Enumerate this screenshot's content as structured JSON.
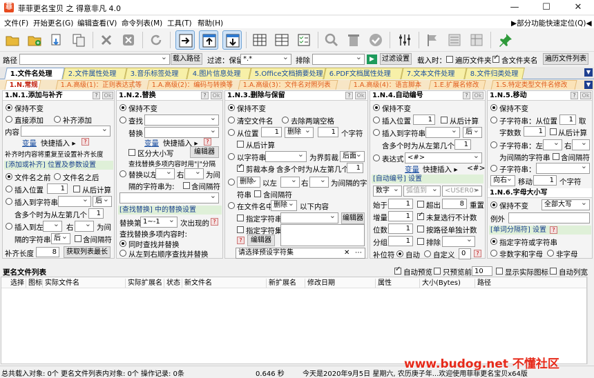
{
  "window": {
    "title": "菲菲更名宝贝 之 得意非凡 4.0",
    "minimize": "—",
    "maximize": "☐",
    "close": "✕"
  },
  "menu": [
    "文件(F)",
    "开始更名(G)",
    "编辑查看(V)",
    "命令列表(M)",
    "工具(T)",
    "帮助(H)"
  ],
  "menu_right": "▶部分功能快速定位(Q)◀",
  "toolbar_icons": [
    "folder-icon",
    "add-folder-icon",
    "import-icon",
    "copy-icon",
    "delete-icon",
    "cancel-icon",
    "refresh-icon",
    "move-right-icon",
    "move-up-icon",
    "move-down-icon",
    "grid-icon",
    "grid2-icon",
    "checklist-icon",
    "search-icon",
    "trash-icon",
    "check-icon",
    "sliders-icon",
    "flag-icon",
    "list-icon",
    "table-icon",
    "pin-icon"
  ],
  "pathbar": {
    "path_label": "路径",
    "load_btn": "载入路径",
    "filter_label": "过滤：保留",
    "filter_value": "*.*",
    "exclude_label": "排除",
    "filter_settings_btn": "过滤设置",
    "load_when": "载入时：",
    "opt_subdirs": "遍历文件夹",
    "opt_include_folder": "含文件夹名",
    "traverse_btn": "遍历文件列表"
  },
  "tabs": [
    "1.文件名处理",
    "2.文件属性处理",
    "3.音乐标签处理",
    "4.图片信息处理",
    "5.Office文档摘要处理",
    "6.PDF文档属性处理",
    "7.文本文件处理",
    "8.文件归类处理"
  ],
  "subtabs": [
    "1.N.常规",
    "1.A.高级(1)：正则表达式等",
    "1.A.高级(2)：编码与转换等",
    "1.A.高级(3)：文件名对照列表",
    "1.A.高级(4)：语言脚本",
    "1.E.扩展名修改",
    "1.S.特定类型文件名修改"
  ],
  "p1": {
    "title": "1.N.1.添加与补齐",
    "keep": "保持不变",
    "direct_add": "直接添加",
    "fill_add": "补齐添加",
    "content_label": "内容",
    "var_link": "变量",
    "var_insert": "快捷插入 ▸",
    "fill_repeat": "补齐时内容将重复至设置补齐长度",
    "section": "[添加或补齐] 位置及参数设置",
    "before_name": "文件名之前",
    "after_name": "文件名之后",
    "insert_pos": "插入位置",
    "insert_pos_val": "1",
    "from_end": "从后计算",
    "insert_to_str": "插入到字符串",
    "after": "后",
    "multi_pos": "含多个时为从左第几个",
    "multi_pos_val": "1",
    "insert_to": "插入到左",
    "right": "右",
    "is_between": "为间",
    "between_str": "隔的字符串",
    "after2": "后",
    "contains_between": "含间隔符",
    "fill_len_label": "补齐长度",
    "fill_len_val": "8",
    "get_max_len_btn": "获取列表最长"
  },
  "p2": {
    "title": "1.N.2.替换",
    "keep": "保持不变",
    "find": "查找",
    "replace": "替换",
    "var_link": "变量",
    "var_insert": "快捷插入 ▸",
    "case": "区分大小写",
    "editor_btn": "编辑器",
    "multi_hint": "查找替换多项内容时用\"|\"分隔",
    "replace_after": "替换以左",
    "right": "右",
    "is_between": "为间",
    "between_str": "隔的字符串为:",
    "contains_between": "含间隔符",
    "section": "[查找替换] 中的替换设置",
    "replace_nth": "替换第",
    "replace_nth_val": "1~-1",
    "nth_suffix": "次出现的",
    "multi_mode": "查找替换多项内容时:",
    "sync_replace": "同时查找并替换",
    "seq_replace": "从左到右顺序查找并替换"
  },
  "p3": {
    "title": "1.N.3.删除与保留",
    "keep": "保持不变",
    "clear_name": "清空文件名",
    "trim_spaces": "去除两端空格",
    "from_pos": "从位置",
    "from_pos_val": "1",
    "delete_word": "删除",
    "count_val": "1",
    "chars": "个字符",
    "from_end": "从后计算",
    "with_str": "以字符串",
    "boundary": "为界剪裁",
    "after": "后面",
    "cut_self": "剪裁本身",
    "multi_pos": "含多个时为从左第几个",
    "multi_pos_val": "1",
    "delete_word2": "删除",
    "left": "以左",
    "right": "右",
    "between": "为间隔的字",
    "str": "符串",
    "contains_between": "含间隔符",
    "in_name": "在文件名中",
    "delete_word3": "删除",
    "following": "以下内容",
    "specify_str": "指定字符串",
    "editor_btn": "编辑器",
    "specify_set": "指定字符集",
    "editor_btn2": "编辑器",
    "preset_placeholder": "请选择预设字符集",
    "preset_clear": "✕",
    "preset_more": "⋯"
  },
  "p4": {
    "title": "1.N.4.自动编号",
    "keep": "保持不变",
    "insert_pos": "插入位置",
    "insert_pos_val": "1",
    "from_end": "从后计算",
    "insert_to_str": "插入到字符串",
    "after": "后",
    "multi_pos": "含多个时为从左第几个",
    "multi_pos_val": "1",
    "expr": "表达式",
    "expr_val": "<#>",
    "var_link": "变量",
    "var_insert": "快捷插入 ▸",
    "var_token": "<#>",
    "section": "[自动编号] 设置",
    "type": "数字",
    "placeholder1": "弧值到",
    "placeholder2": "<USER0>",
    "start_label": "始于",
    "start_val": "1",
    "exceed": "超出",
    "exceed_val": "8",
    "reset": "重置",
    "step_label": "增量",
    "step_val": "1",
    "no_compute": "未复选行不计数",
    "digits_label": "位数",
    "digits_val": "1",
    "by_path": "按路径单独计数",
    "group_label": "分组",
    "group_val": "1",
    "sort": "排除",
    "pad_label": "补位符",
    "auto": "自动",
    "custom": "自定义",
    "custom_val": "0"
  },
  "p5": {
    "title": "1.N.5.移动",
    "keep": "保持不变",
    "substr_label": "子字符串：从位置",
    "pos_val": "1",
    "take": "取",
    "count_label": "字数数",
    "count_val": "1",
    "from_end": "从后计算",
    "substr2": "子字符串：左",
    "right": "右",
    "between_str": "为间隔的字符串",
    "contains_between": "含间隔符",
    "substr3": "子字符串：",
    "direction": "向右",
    "move_label": "移动",
    "move_val": "1",
    "chars": "个字符",
    "case_title": "1.N.6.字母大小写",
    "case_keep": "保持不变",
    "all_upper": "全部大写",
    "exception": "例外",
    "word_section": "[单词分隔符] 设置",
    "specify_word": "指定字符或字符串",
    "non_alpha_num": "非数字和字母",
    "non_alpha": "非字母"
  },
  "list": {
    "title": "更名文件列表",
    "auto_preview": "自动预览",
    "preview_only": "只预览前",
    "preview_count": "10",
    "show_icons": "显示实际图标",
    "auto_col": "自动列宽",
    "columns": [
      "选择",
      "图标",
      "实际文件名",
      "实际扩展名",
      "状态",
      "新文件名",
      "新扩展名",
      "修改日期",
      "属性",
      "大小(Bytes)",
      "路径"
    ]
  },
  "status": {
    "loaded": "总共载入对象: 0个",
    "renamed": "更名文件列表内对象: 0个",
    "log": "操作记录: 0条",
    "time": "0.646 秒",
    "date": "今天是2020年9月5日 星期六, 农历庚子年...欢迎使用菲菲更名宝贝x64版"
  },
  "watermark": "www.budog.net 不懂社区"
}
